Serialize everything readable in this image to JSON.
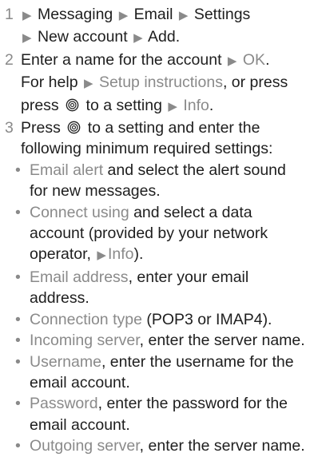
{
  "steps": [
    {
      "number": "1",
      "path": [
        "Messaging",
        "Email",
        "Settings",
        "New account",
        "Add"
      ],
      "end": "."
    },
    {
      "number": "2",
      "text_a": "Enter a name for the account",
      "ok": "OK",
      "text_b": "For help",
      "setup_link": "Setup instructions",
      "text_c": ", or press",
      "text_d": "to a setting",
      "info": "Info",
      "end": "."
    },
    {
      "number": "3",
      "text_a": "Press",
      "text_b": "to a setting and enter the following minimum required settings:",
      "bullets": [
        {
          "term": "Email alert",
          "rest": " and select the alert sound for new messages."
        },
        {
          "term": "Connect using",
          "rest": " and select a data account (provided by your network operator, ",
          "ref": "Info",
          "end": ")."
        },
        {
          "term": "Email address",
          "rest": ", enter your email address."
        },
        {
          "term": "Connection type",
          "rest": " (POP3 or IMAP4)."
        },
        {
          "term": "Incoming server",
          "rest": ", enter the server name."
        },
        {
          "term": "Username",
          "rest": ", enter the username for the email account."
        },
        {
          "term": "Password",
          "rest": ", enter the password for the email account."
        },
        {
          "term": "Outgoing server",
          "rest": ", enter the server name."
        }
      ]
    }
  ],
  "icons": {
    "arrow": "right-pointing-triangle",
    "navkey": "navigation-key-icon"
  },
  "colors": {
    "text": "#1e1e1e",
    "accent_gray": "#8a8a8a"
  }
}
